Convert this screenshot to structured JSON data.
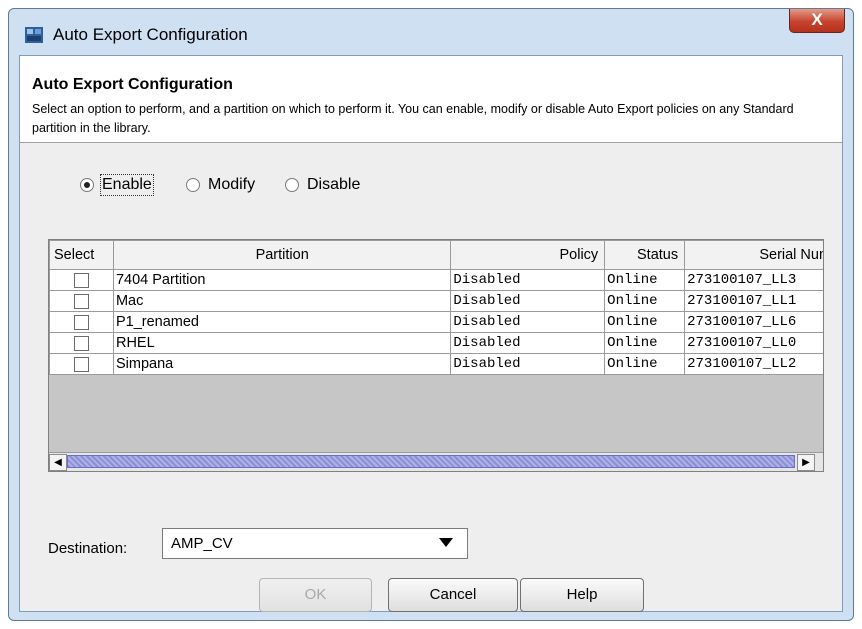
{
  "window": {
    "title": "Auto Export Configuration",
    "icons": {
      "app": "app-icon",
      "close": "close-icon"
    },
    "close_glyph": "X"
  },
  "header": {
    "title": "Auto Export Configuration",
    "description": "Select an option to perform, and a partition on which to perform it. You can enable, modify or disable Auto Export policies on any Standard partition in the library."
  },
  "options": {
    "selected": "Enable",
    "items": [
      "Enable",
      "Modify",
      "Disable"
    ]
  },
  "table": {
    "columns": [
      "Select",
      "Partition",
      "Policy",
      "Status",
      "Serial Number"
    ],
    "rows": [
      {
        "selected": false,
        "partition": "7404 Partition",
        "policy": "Disabled",
        "status": "Online",
        "serial": "273100107_LL3"
      },
      {
        "selected": false,
        "partition": "Mac",
        "policy": "Disabled",
        "status": "Online",
        "serial": "273100107_LL1"
      },
      {
        "selected": false,
        "partition": "P1_renamed",
        "policy": "Disabled",
        "status": "Online",
        "serial": "273100107_LL6"
      },
      {
        "selected": false,
        "partition": "RHEL",
        "policy": "Disabled",
        "status": "Online",
        "serial": "273100107_LL0"
      },
      {
        "selected": false,
        "partition": "Simpana",
        "policy": "Disabled",
        "status": "Online",
        "serial": "273100107_LL2"
      }
    ]
  },
  "scrollbar": {
    "left_glyph": "◀",
    "right_glyph": "▶"
  },
  "destination": {
    "label": "Destination:",
    "value": "AMP_CV"
  },
  "buttons": {
    "ok": "OK",
    "cancel": "Cancel",
    "help": "Help"
  },
  "colors": {
    "title_bar": "#cfe0f2",
    "close_button": "#c6432c",
    "scroll_thumb": "#8b8fd6"
  }
}
